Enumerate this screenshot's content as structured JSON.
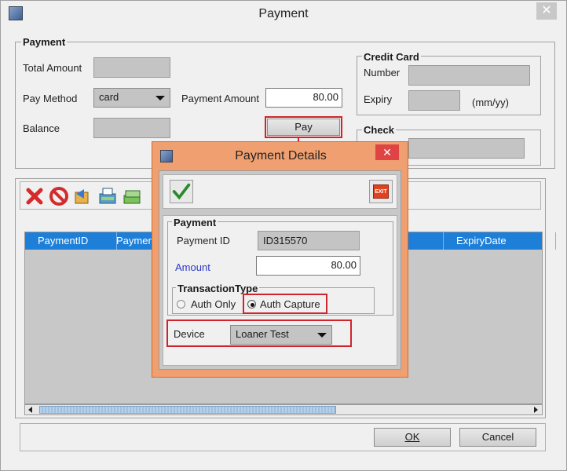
{
  "window": {
    "title": "Payment",
    "close_glyph": "✕"
  },
  "payment_group": {
    "title": "Payment",
    "total_amount_label": "Total Amount",
    "pay_method_label": "Pay Method",
    "pay_method_value": "card",
    "payment_amount_label": "Payment Amount",
    "payment_amount_value": "80.00",
    "balance_label": "Balance",
    "pay_button": "Pay"
  },
  "credit_card": {
    "title": "Credit Card",
    "number_label": "Number",
    "expiry_label": "Expiry",
    "expiry_hint": "(mm/yy)"
  },
  "check": {
    "title": "Check"
  },
  "table": {
    "columns": [
      "PaymentID",
      "Payment",
      "ExpiryDate"
    ]
  },
  "footer": {
    "ok_button": "OK",
    "cancel_button": "Cancel"
  },
  "dialog": {
    "title": "Payment Details",
    "close_glyph": "✕",
    "exit_label": "EXIT",
    "group_title": "Payment",
    "payment_id_label": "Payment ID",
    "payment_id_value": "ID315570",
    "amount_label": "Amount",
    "amount_value": "80.00",
    "transaction_type_title": "TransactionType",
    "auth_only_label": "Auth Only",
    "auth_capture_label": "Auth Capture",
    "device_label": "Device",
    "device_value": "Loaner Test"
  },
  "colors": {
    "highlight": "#d0242c",
    "dialog_frame": "#f0a070",
    "table_header": "#1e7fd8",
    "amount_label": "#2a38c8"
  }
}
